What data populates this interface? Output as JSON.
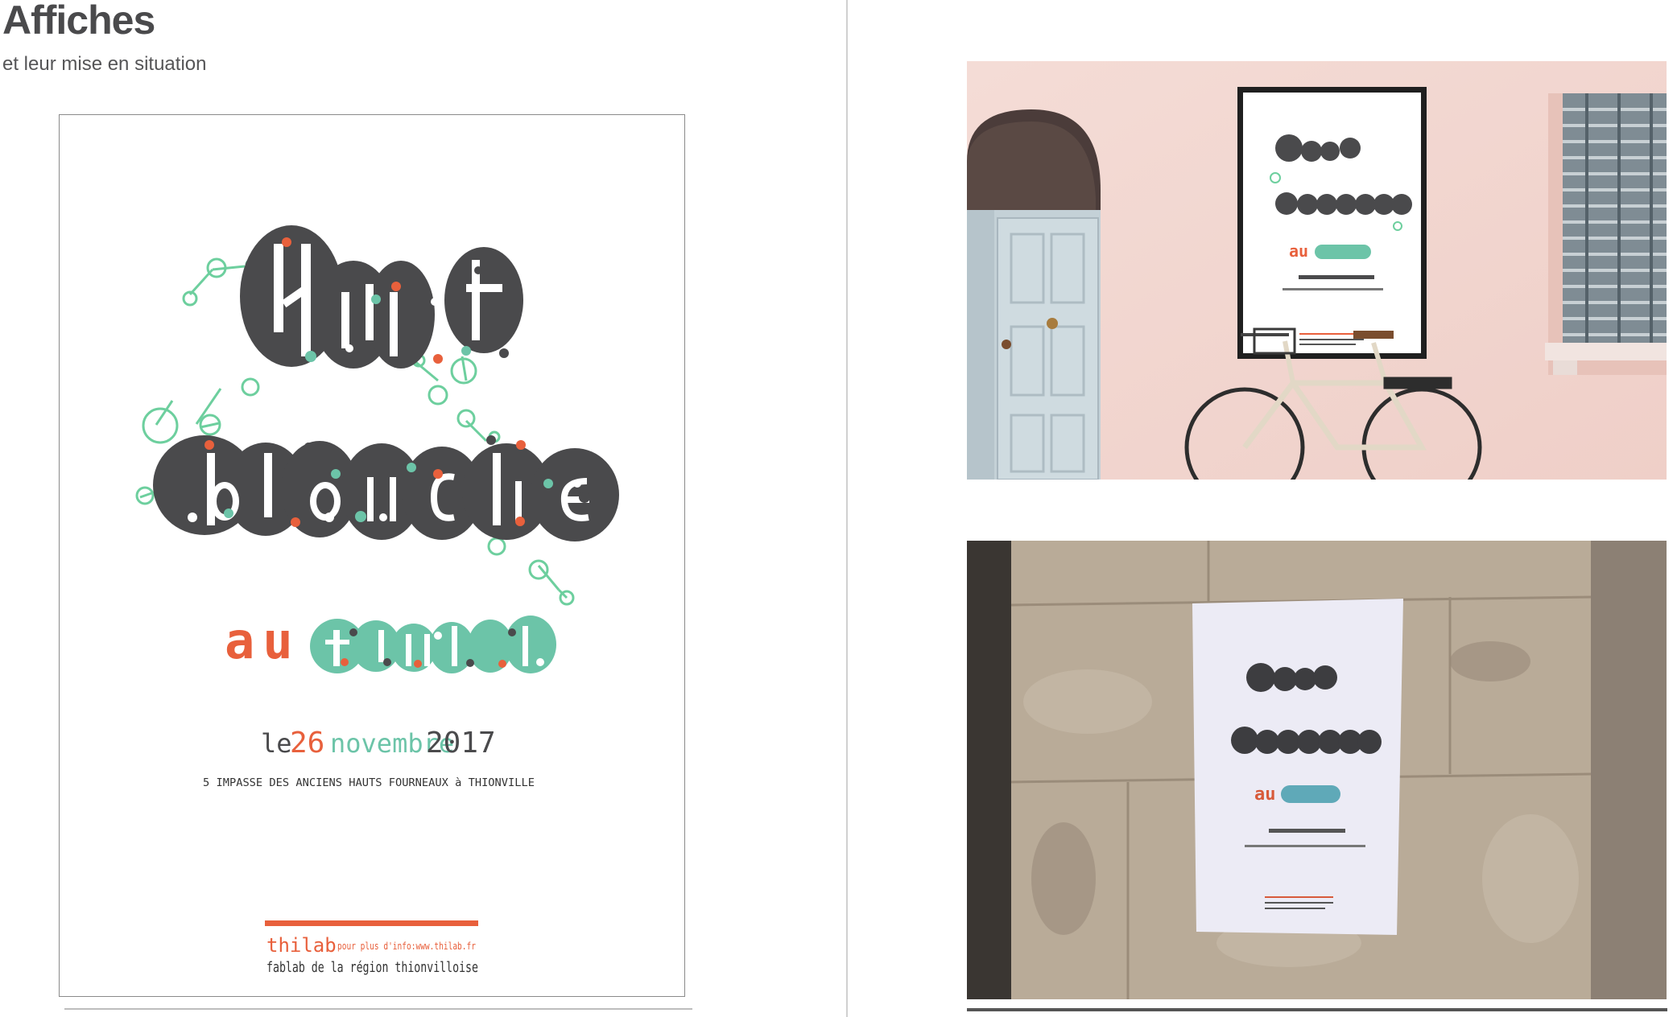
{
  "header": {
    "title": "Affiches",
    "subtitle": "et leur mise en situation"
  },
  "poster": {
    "title_line1": "Nuit",
    "title_line2": "blanche",
    "prefix": "au",
    "venue": "fablab",
    "date_le": "le",
    "date_day": "26",
    "date_month": "novembre",
    "date_year": "2017",
    "address": "5 IMPASSE DES ANCIENS HAUTS FOURNEAUX à THIONVILLE",
    "brand": "thilab",
    "info": "pour plus d'info:www.thilab.fr",
    "tagline": "fablab de la région thionvilloise"
  },
  "colors": {
    "dark": "#4a4a4c",
    "orange": "#e8603c",
    "teal": "#6cc4a8",
    "green_line": "#6dcf9e",
    "wall_pink": "#f2d6d0",
    "door": "#c6d3d9",
    "stone": "#b8aa99"
  },
  "icons": {
    "bicycle": "bicycle-icon",
    "door": "door-icon",
    "window": "window-icon"
  }
}
